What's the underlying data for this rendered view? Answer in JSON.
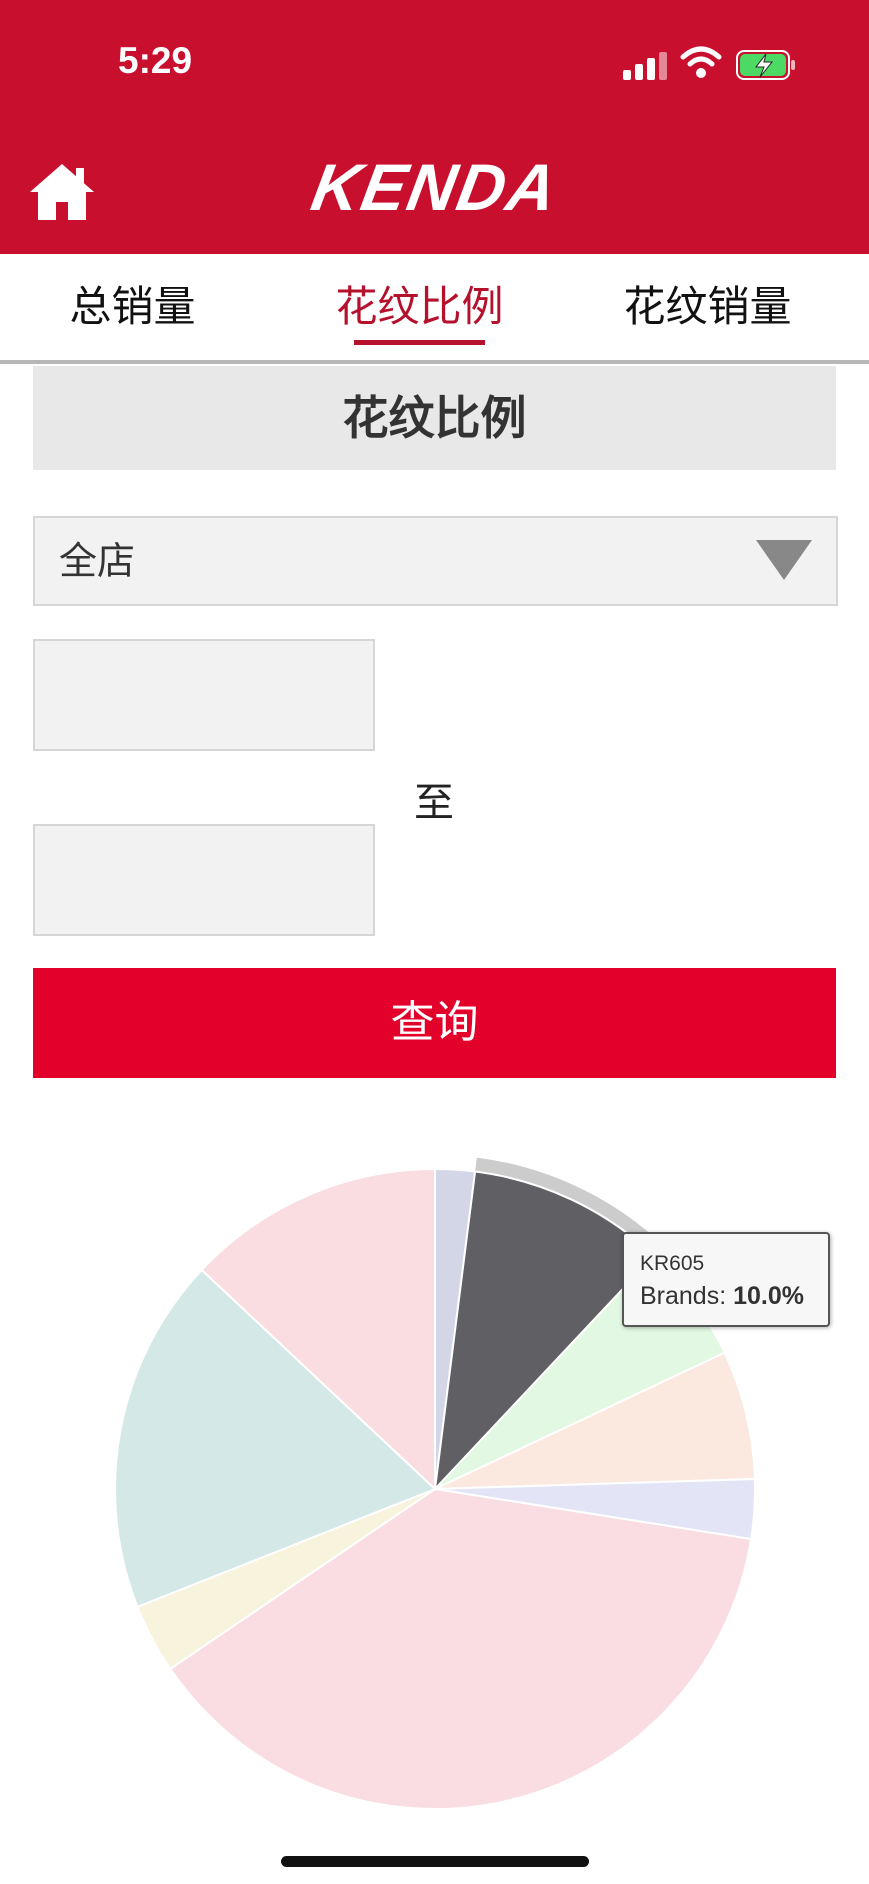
{
  "status_bar": {
    "time": "5:29"
  },
  "header": {
    "logo": "KENDA",
    "brand_color": "#c8102e"
  },
  "tabs": [
    {
      "label": "总销量",
      "active": false
    },
    {
      "label": "花纹比例",
      "active": true
    },
    {
      "label": "花纹销量",
      "active": false
    }
  ],
  "section": {
    "title": "花纹比例"
  },
  "filters": {
    "store_select": {
      "value": "全店"
    },
    "start_date": {
      "value": "",
      "placeholder": ""
    },
    "to_label": "至",
    "end_date": {
      "value": "",
      "placeholder": ""
    },
    "query_label": "查询",
    "query_color": "#e3002b"
  },
  "chart_data": {
    "type": "pie",
    "title": "",
    "slices": [
      {
        "value": 2.0,
        "color": "#d3d6e6"
      },
      {
        "value": 10.0,
        "color": "#5f5f64",
        "label": "KR605",
        "highlighted": true
      },
      {
        "value": 6.0,
        "color": "#e2f8e2"
      },
      {
        "value": 6.5,
        "color": "#fbe8df"
      },
      {
        "value": 3.0,
        "color": "#e3e5f7"
      },
      {
        "value": 38.0,
        "color": "#fadde2"
      },
      {
        "value": 3.5,
        "color": "#f7f3dc"
      },
      {
        "value": 18.0,
        "color": "#d4e8e7"
      },
      {
        "value": 13.0,
        "color": "#fadde0"
      }
    ]
  },
  "tooltip": {
    "name": "KR605",
    "series_label": "Brands: ",
    "value": "10.0%"
  }
}
